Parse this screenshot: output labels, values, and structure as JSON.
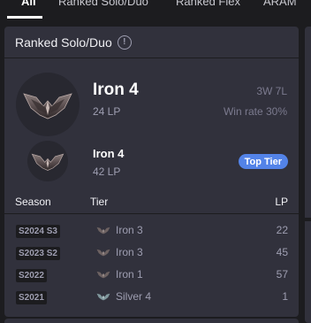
{
  "tabs": [
    {
      "label": "All",
      "active": true
    },
    {
      "label": "Ranked Solo/Duo",
      "active": false
    },
    {
      "label": "Ranked Flex",
      "active": false
    },
    {
      "label": "ARAM",
      "active": false
    }
  ],
  "card": {
    "title": "Ranked Solo/Duo",
    "info_icon": "info-icon",
    "current": {
      "tier": "Iron 4",
      "lp": "24 LP",
      "record": "3W 7L",
      "win_rate": "Win rate 30%"
    },
    "peak": {
      "tier": "Iron 4",
      "lp": "42 LP",
      "badge": "Top Tier"
    },
    "table": {
      "headers": {
        "season": "Season",
        "tier": "Tier",
        "lp": "LP"
      },
      "rows": [
        {
          "season": "S2024 S3",
          "tier": "Iron 3",
          "lp": "22",
          "emblem": "iron"
        },
        {
          "season": "S2023 S2",
          "tier": "Iron 3",
          "lp": "45",
          "emblem": "iron"
        },
        {
          "season": "S2022",
          "tier": "Iron 1",
          "lp": "57",
          "emblem": "iron"
        },
        {
          "season": "S2021",
          "tier": "Silver 4",
          "lp": "1",
          "emblem": "silver"
        }
      ]
    }
  },
  "colors": {
    "background": "#1c1c1f",
    "card": "#31313c",
    "accent": "#5383e8",
    "muted_text": "#9e9eb1"
  }
}
